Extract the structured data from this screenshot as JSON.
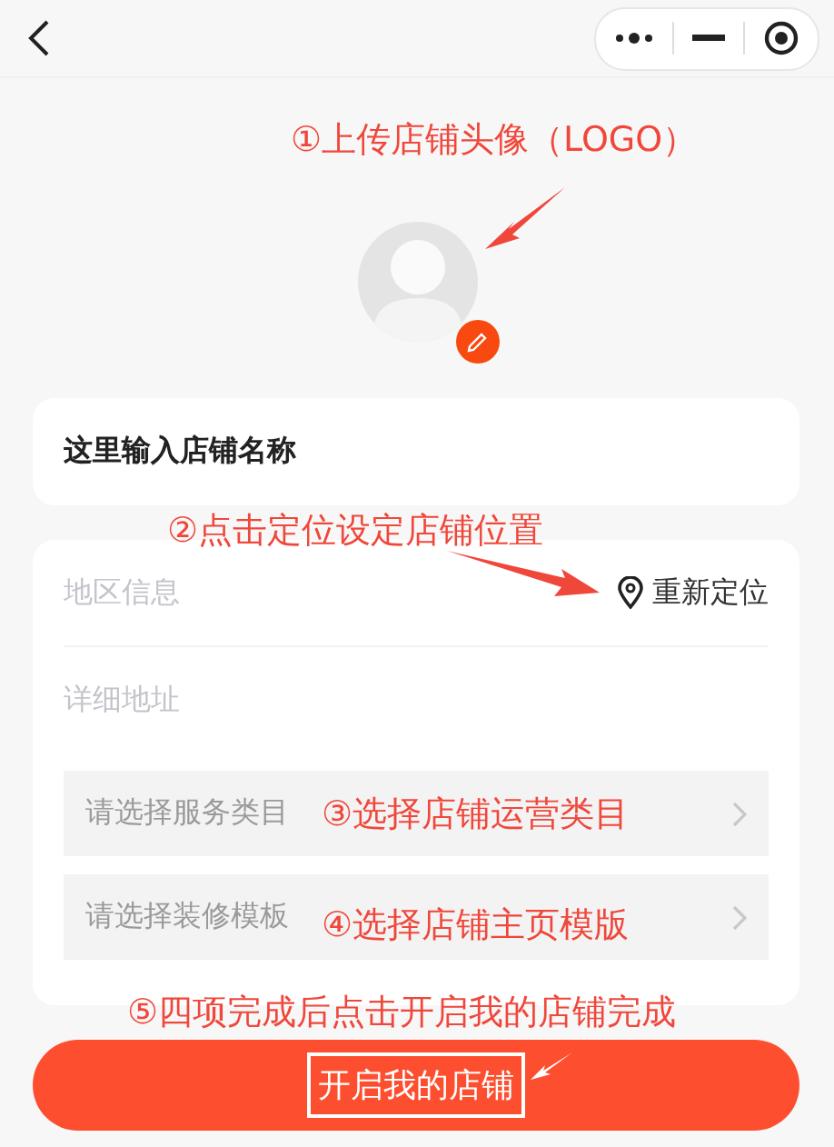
{
  "store_name": {
    "value": "这里输入店铺名称"
  },
  "location": {
    "placeholder": "地区信息",
    "relocate": "重新定位"
  },
  "address": {
    "placeholder": "详细地址"
  },
  "selects": [
    {
      "placeholder": "请选择服务类目"
    },
    {
      "placeholder": "请选择装修模板"
    }
  ],
  "submit": {
    "label": "开启我的店铺",
    "highlighted": true
  },
  "annotations": [
    {
      "text": "①上传店铺头像（LOGO）"
    },
    {
      "text": "②点击定位设定店铺位置"
    },
    {
      "text": "③选择店铺运营类目"
    },
    {
      "text": "④选择店铺主页模版"
    },
    {
      "text": "⑤四项完成后点击开启我的店铺完成"
    }
  ]
}
